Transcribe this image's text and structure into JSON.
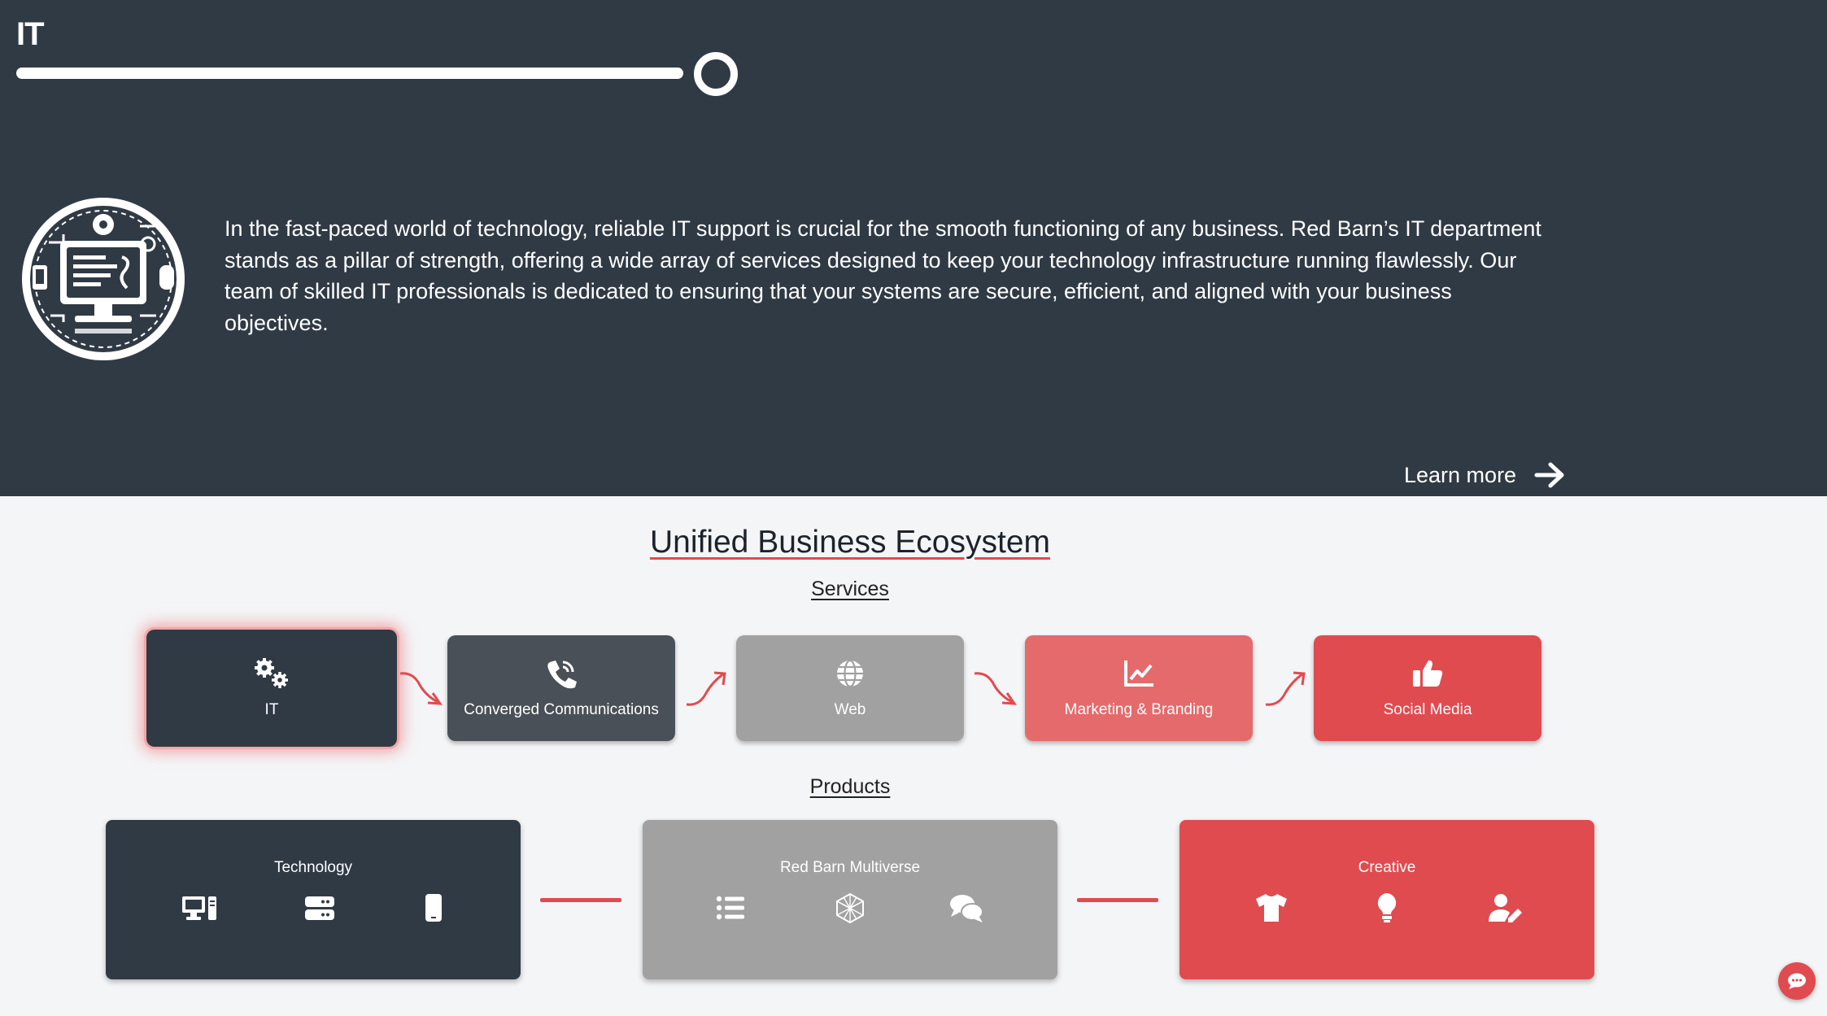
{
  "hero": {
    "title": "IT",
    "progress_percent": 100,
    "description": "In the fast-paced world of technology, reliable IT support is crucial for the smooth functioning of any business. Red Barn’s IT department stands as a pillar of strength, offering a wide array of services designed to keep your technology infrastructure running flawlessly. Our team of skilled IT professionals is dedicated to ensuring that your systems are secure, efficient, and aligned with your business objectives.",
    "learn_more_label": "Learn more",
    "emblem_icon": "it-computer-emblem-icon"
  },
  "ecosystem": {
    "title": "Unified Business Ecosystem",
    "services_heading": "Services",
    "products_heading": "Products",
    "services": [
      {
        "label": "IT",
        "icon": "gears-icon",
        "color": "#303a45",
        "active": true
      },
      {
        "label": "Converged Communications",
        "icon": "phone-volume-icon",
        "color": "#4a5057"
      },
      {
        "label": "Web",
        "icon": "globe-icon",
        "color": "#a1a1a1"
      },
      {
        "label": "Marketing & Branding",
        "icon": "chart-line-icon",
        "color": "#e46a6c"
      },
      {
        "label": "Social Media",
        "icon": "thumbs-up-icon",
        "color": "#e04b4f"
      }
    ],
    "products": [
      {
        "label": "Technology",
        "color": "#303a45",
        "icons": [
          "desktop-icon",
          "server-icon",
          "mobile-icon"
        ]
      },
      {
        "label": "Red Barn Multiverse",
        "color": "#a1a1a1",
        "icons": [
          "list-icon",
          "hexagon-mesh-icon",
          "comments-icon"
        ]
      },
      {
        "label": "Creative",
        "color": "#e04b4f",
        "icons": [
          "shirt-icon",
          "lightbulb-icon",
          "user-pen-icon"
        ]
      }
    ]
  },
  "chat": {
    "icon": "chat-bubble-icon"
  },
  "colors": {
    "dark": "#303a45",
    "accent": "#e04b4f",
    "grey": "#a1a1a1",
    "light_bg": "#f4f5f7"
  }
}
